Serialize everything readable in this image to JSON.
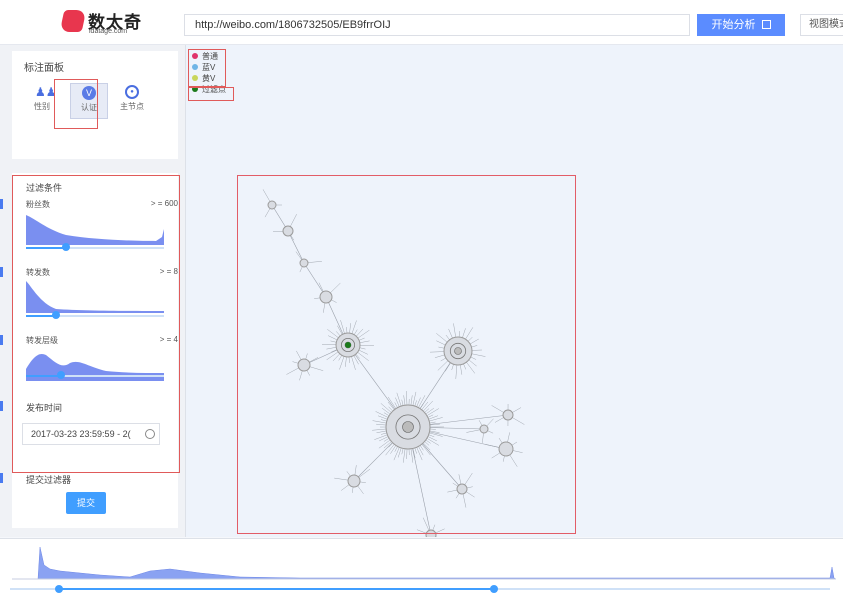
{
  "header": {
    "logo_text": "数太奇",
    "logo_sub": "idatage.com",
    "url_value": "http://weibo.com/1806732505/EB9frrOIJ",
    "analyze_label": "开始分析",
    "view_mode_label": "视图模式"
  },
  "annotation_panel": {
    "title": "标注面板",
    "items": [
      {
        "label": "性别",
        "icon": "gender-icon"
      },
      {
        "label": "认证",
        "icon": "verify-icon"
      },
      {
        "label": "主节点",
        "icon": "main-node-icon"
      }
    ]
  },
  "filter_panel": {
    "title": "过滤条件",
    "filters": [
      {
        "label": "粉丝数",
        "value": "> = 600",
        "slider_fraction": 0.29
      },
      {
        "label": "转发数",
        "value": "> = 8",
        "slider_fraction": 0.22
      },
      {
        "label": "转发层级",
        "value": "> = 4",
        "slider_fraction": 0.25
      }
    ],
    "date_label": "发布时间",
    "date_value": "2017-03-23 23:59:59 - 2(",
    "submit_section_label": "提交过滤器",
    "submit_label": "提交"
  },
  "legend": {
    "items": [
      {
        "label": "普通",
        "color": "#e0336b"
      },
      {
        "label": "蓝V",
        "color": "#6fb5e6"
      },
      {
        "label": "黄V",
        "color": "#c9d65b"
      },
      {
        "label": "过滤点",
        "color": "#1b7a1b"
      }
    ]
  },
  "timeline": {
    "range_start_fraction": 0.06,
    "range_end_fraction": 0.59
  },
  "colors": {
    "accent": "#409eff",
    "highlight": "#e05a5a",
    "node": "#9a9a9a"
  }
}
